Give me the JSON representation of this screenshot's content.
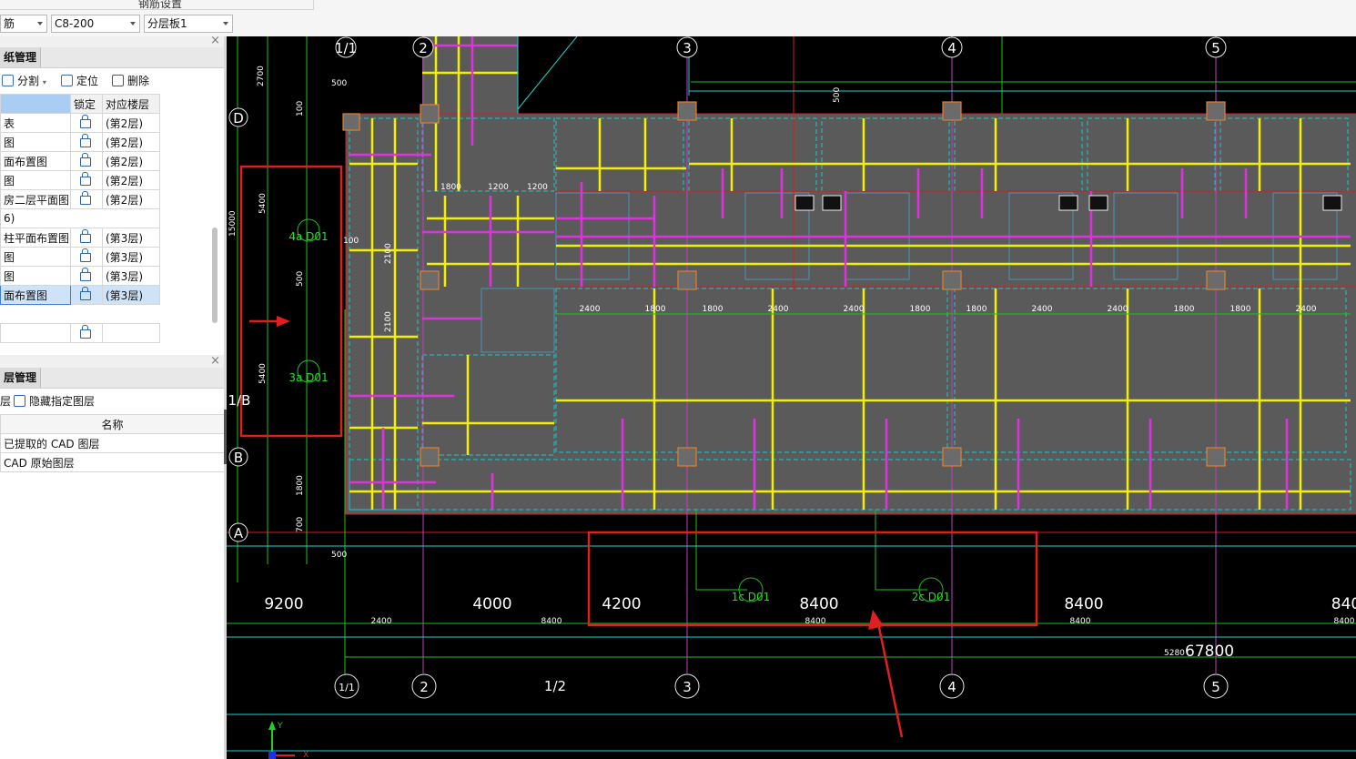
{
  "topbar": {
    "title": "钢筋设置",
    "combo1": "筋",
    "combo2": "C8-200",
    "combo3": "分层板1"
  },
  "drawing_panel": {
    "tab_label": "纸管理",
    "toolbar": {
      "split": "分割",
      "locate": "定位",
      "delete": "删除"
    },
    "columns": {
      "name": "",
      "lock": "锁定",
      "floor": "对应楼层"
    },
    "rows": [
      {
        "name": "表",
        "floor": "(第2层)"
      },
      {
        "name": "图",
        "floor": "(第2层)"
      },
      {
        "name": "面布置图",
        "floor": "(第2层)"
      },
      {
        "name": "图",
        "floor": "(第2层)"
      },
      {
        "name": "房二层平面图",
        "floor": "(第2层)"
      },
      {
        "name": "6)",
        "floor": ""
      },
      {
        "name": "柱平面布置图",
        "floor": "(第3层)"
      },
      {
        "name": "图",
        "floor": "(第3层)"
      },
      {
        "name": "图",
        "floor": "(第3层)"
      },
      {
        "name": "面布置图",
        "floor": "(第3层)"
      }
    ]
  },
  "layer_panel": {
    "tab_label": "层管理",
    "toolbar": {
      "show": "层",
      "hide": "隐藏指定图层"
    },
    "column_name": "名称",
    "rows": [
      "已提取的 CAD 图层",
      "CAD 原始图层"
    ]
  },
  "cad": {
    "axis_labels_top": [
      "1/1",
      "2",
      "3",
      "4",
      "5"
    ],
    "axis_labels_bottom": [
      "1/1",
      "2",
      "1/2",
      "3",
      "4",
      "5"
    ],
    "row_labels": [
      "D",
      "1/B",
      "B",
      "A"
    ],
    "grid_spans": [
      "9200",
      "4000",
      "4200",
      "8400",
      "8400",
      "840"
    ],
    "sub_dims_bottom": [
      "2400",
      "8400",
      "8400",
      "8400",
      "8400"
    ],
    "total_dim": "67800",
    "total_prefix": "5280",
    "beam_tags": [
      "4a D01",
      "3a D01",
      "1c D01",
      "2c D01"
    ],
    "left_dims": [
      "2700",
      "500",
      "100",
      "5400",
      "15000",
      "500",
      "5400",
      "1800",
      "700",
      "500"
    ],
    "inner_dims_row": [
      "2400",
      "1800",
      "1800",
      "2400",
      "2400",
      "1800",
      "1800",
      "2400",
      "2400",
      "1800",
      "1800",
      "2400"
    ],
    "small_dims": [
      "1800",
      "1200",
      "1200",
      "2100",
      "2100",
      "100",
      "500"
    ],
    "coord_x": "X",
    "coord_y": "Y"
  }
}
